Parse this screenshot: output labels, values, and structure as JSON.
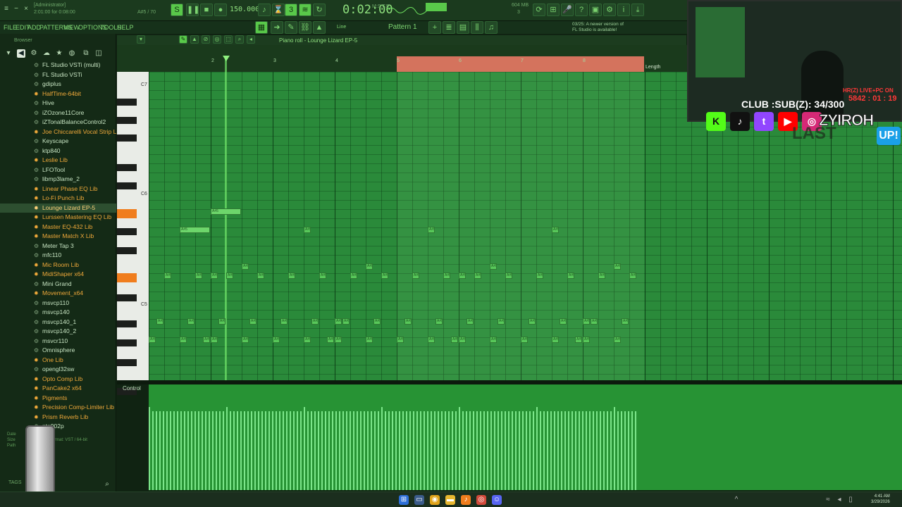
{
  "titlebar": {
    "admin_label": "[Administrator]",
    "song_position_label": "2:01:00 for 0:08:00",
    "key_info": "A#5 / 70"
  },
  "transport": {
    "tempo": "150.000",
    "time": "0:02:00",
    "time_suffix": "M:S:CS",
    "cpu": "604 MB",
    "cpu_cores": "3"
  },
  "menu": {
    "items": [
      "FILE",
      "EDIT",
      "ADD",
      "PATTERNS",
      "VIEW",
      "OPTIONS",
      "TOOLS",
      "HELP"
    ]
  },
  "pattern": {
    "label": "Pattern 1"
  },
  "line_label": "Line",
  "notice": {
    "line1": "03/25: A newer version of",
    "line2": "FL Studio is available!"
  },
  "browser": {
    "header": "Browser",
    "plugins": [
      {
        "label": "FL Studio VSTi (multi)",
        "kind": "generic"
      },
      {
        "label": "FL Studio VSTi",
        "kind": "generic"
      },
      {
        "label": "gdiplus",
        "kind": "generic"
      },
      {
        "label": "HalfTime-64bit",
        "kind": "fx"
      },
      {
        "label": "Hive",
        "kind": "generic"
      },
      {
        "label": "iZOzone11Core",
        "kind": "generic"
      },
      {
        "label": "iZTonalBalanceControl2",
        "kind": "generic"
      },
      {
        "label": "Joe Chiccarelli Vocal Strip Lib",
        "kind": "fx"
      },
      {
        "label": "Keyscape",
        "kind": "generic"
      },
      {
        "label": "ktp840",
        "kind": "generic"
      },
      {
        "label": "Leslie Lib",
        "kind": "fx"
      },
      {
        "label": "LFOTool",
        "kind": "generic"
      },
      {
        "label": "libmp3lame_2",
        "kind": "generic"
      },
      {
        "label": "Linear Phase EQ Lib",
        "kind": "fx"
      },
      {
        "label": "Lo-Fi Punch Lib",
        "kind": "fx"
      },
      {
        "label": "Lounge Lizard EP-5",
        "kind": "selected"
      },
      {
        "label": "Lurssen Mastering EQ Lib",
        "kind": "fx"
      },
      {
        "label": "Master EQ-432 Lib",
        "kind": "fx"
      },
      {
        "label": "Master Match X Lib",
        "kind": "fx"
      },
      {
        "label": "Meter Tap 3",
        "kind": "generic"
      },
      {
        "label": "mfc110",
        "kind": "generic"
      },
      {
        "label": "Mic Room Lib",
        "kind": "fx"
      },
      {
        "label": "MidiShaper x64",
        "kind": "fx"
      },
      {
        "label": "Mini Grand",
        "kind": "generic"
      },
      {
        "label": "Movement_x64",
        "kind": "fx"
      },
      {
        "label": "msvcp110",
        "kind": "generic"
      },
      {
        "label": "msvcp140",
        "kind": "generic"
      },
      {
        "label": "msvcp140_1",
        "kind": "generic"
      },
      {
        "label": "msvcp140_2",
        "kind": "generic"
      },
      {
        "label": "msvcr110",
        "kind": "generic"
      },
      {
        "label": "Omnisphere",
        "kind": "generic"
      },
      {
        "label": "One Lib",
        "kind": "fx"
      },
      {
        "label": "opengl32sw",
        "kind": "generic"
      },
      {
        "label": "Opto Comp Lib",
        "kind": "fx"
      },
      {
        "label": "PanCake2 x64",
        "kind": "fx"
      },
      {
        "label": "Pigments",
        "kind": "fx"
      },
      {
        "label": "Precision Comp-Limiter Lib",
        "kind": "fx"
      },
      {
        "label": "Prism Reverb Lib",
        "kind": "fx"
      },
      {
        "label": "ptg902p",
        "kind": "generic"
      }
    ],
    "info": {
      "date": "Date",
      "size": "Size",
      "path": "Path",
      "format": "Format: VST / 64-bit"
    },
    "tags_label": "TAGS"
  },
  "piano_roll": {
    "title": "Piano roll - Lounge Lizard EP-5",
    "length_label": "Length",
    "octaves": [
      "C7",
      "C6",
      "C5"
    ],
    "bar_numbers": [
      "2",
      "3",
      "4",
      "5",
      "6",
      "7",
      "8"
    ],
    "note_label": "A#5"
  },
  "control": {
    "label": "Control"
  },
  "overlay": {
    "live_text": "HR(Z) LIVE+PC ON",
    "timer": "5842 : 01 : 19",
    "club_text": "CLUB :SUB(Z): 34/300",
    "handle": "ZYIROH",
    "banner": "LAST",
    "badge": "UP!",
    "social": [
      "K",
      "♪",
      "t",
      "▶",
      "◎"
    ]
  },
  "taskbar": {
    "time": "4:41 AM",
    "date": "3/29/2026"
  },
  "colors": {
    "accent": "#59c94a",
    "piano_highlight": "#f07d1d",
    "selection": "#d4735d"
  }
}
